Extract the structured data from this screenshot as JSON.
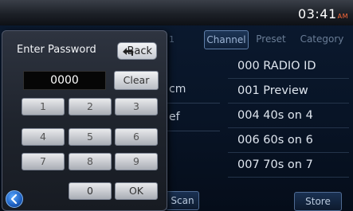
{
  "status": {
    "time": "03:41",
    "ampm": "AM"
  },
  "radio": {
    "tab_stub": "1",
    "tabs": [
      "Channel",
      "Preset",
      "Category"
    ],
    "active_tab": "Channel",
    "bg_labels": [
      "cm",
      "ef"
    ],
    "channels": [
      "000 RADIO ID",
      "001 Preview",
      "004 40s on 4",
      "006 60s on 6",
      "007 70s on 7"
    ],
    "scan_label": "Scan",
    "store_label": "Store"
  },
  "dialog": {
    "title": "Enter Password",
    "back_label": "Back",
    "password_value": "0000",
    "clear_label": "Clear",
    "keys": [
      "1",
      "2",
      "3",
      "4",
      "5",
      "6",
      "7",
      "8",
      "9",
      "0",
      "OK"
    ]
  },
  "icons": {
    "back": "back-arrow-icon",
    "nav": "chevron-left-icon"
  },
  "colors": {
    "accent": "#ff6a3a",
    "nav_blue": "#1d5fbf"
  }
}
